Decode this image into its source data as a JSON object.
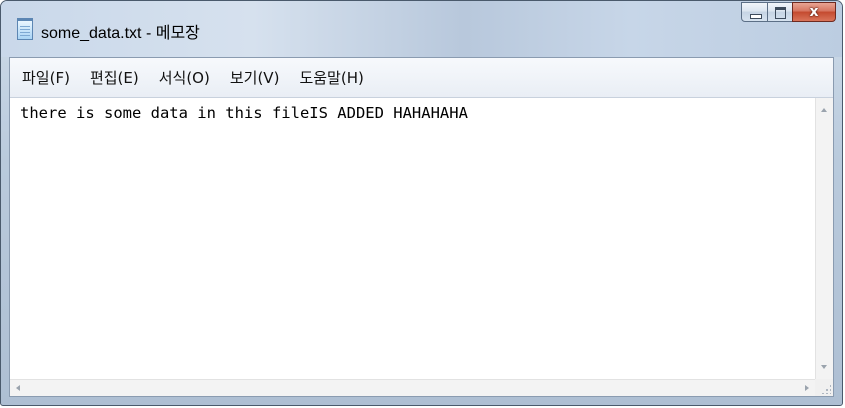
{
  "window": {
    "title": "some_data.txt - 메모장",
    "icon": "notepad-icon",
    "caption_buttons": {
      "minimize_icon": "minimize-icon",
      "maximize_icon": "maximize-icon",
      "close_glyph": "x"
    },
    "close_color": "#c44a2f"
  },
  "menu": {
    "items": [
      {
        "label": "파일(F)"
      },
      {
        "label": "편집(E)"
      },
      {
        "label": "서식(O)"
      },
      {
        "label": "보기(V)"
      },
      {
        "label": "도움말(H)"
      }
    ]
  },
  "editor": {
    "content": "there is some data in this fileIS ADDED HAHAHAHA"
  }
}
